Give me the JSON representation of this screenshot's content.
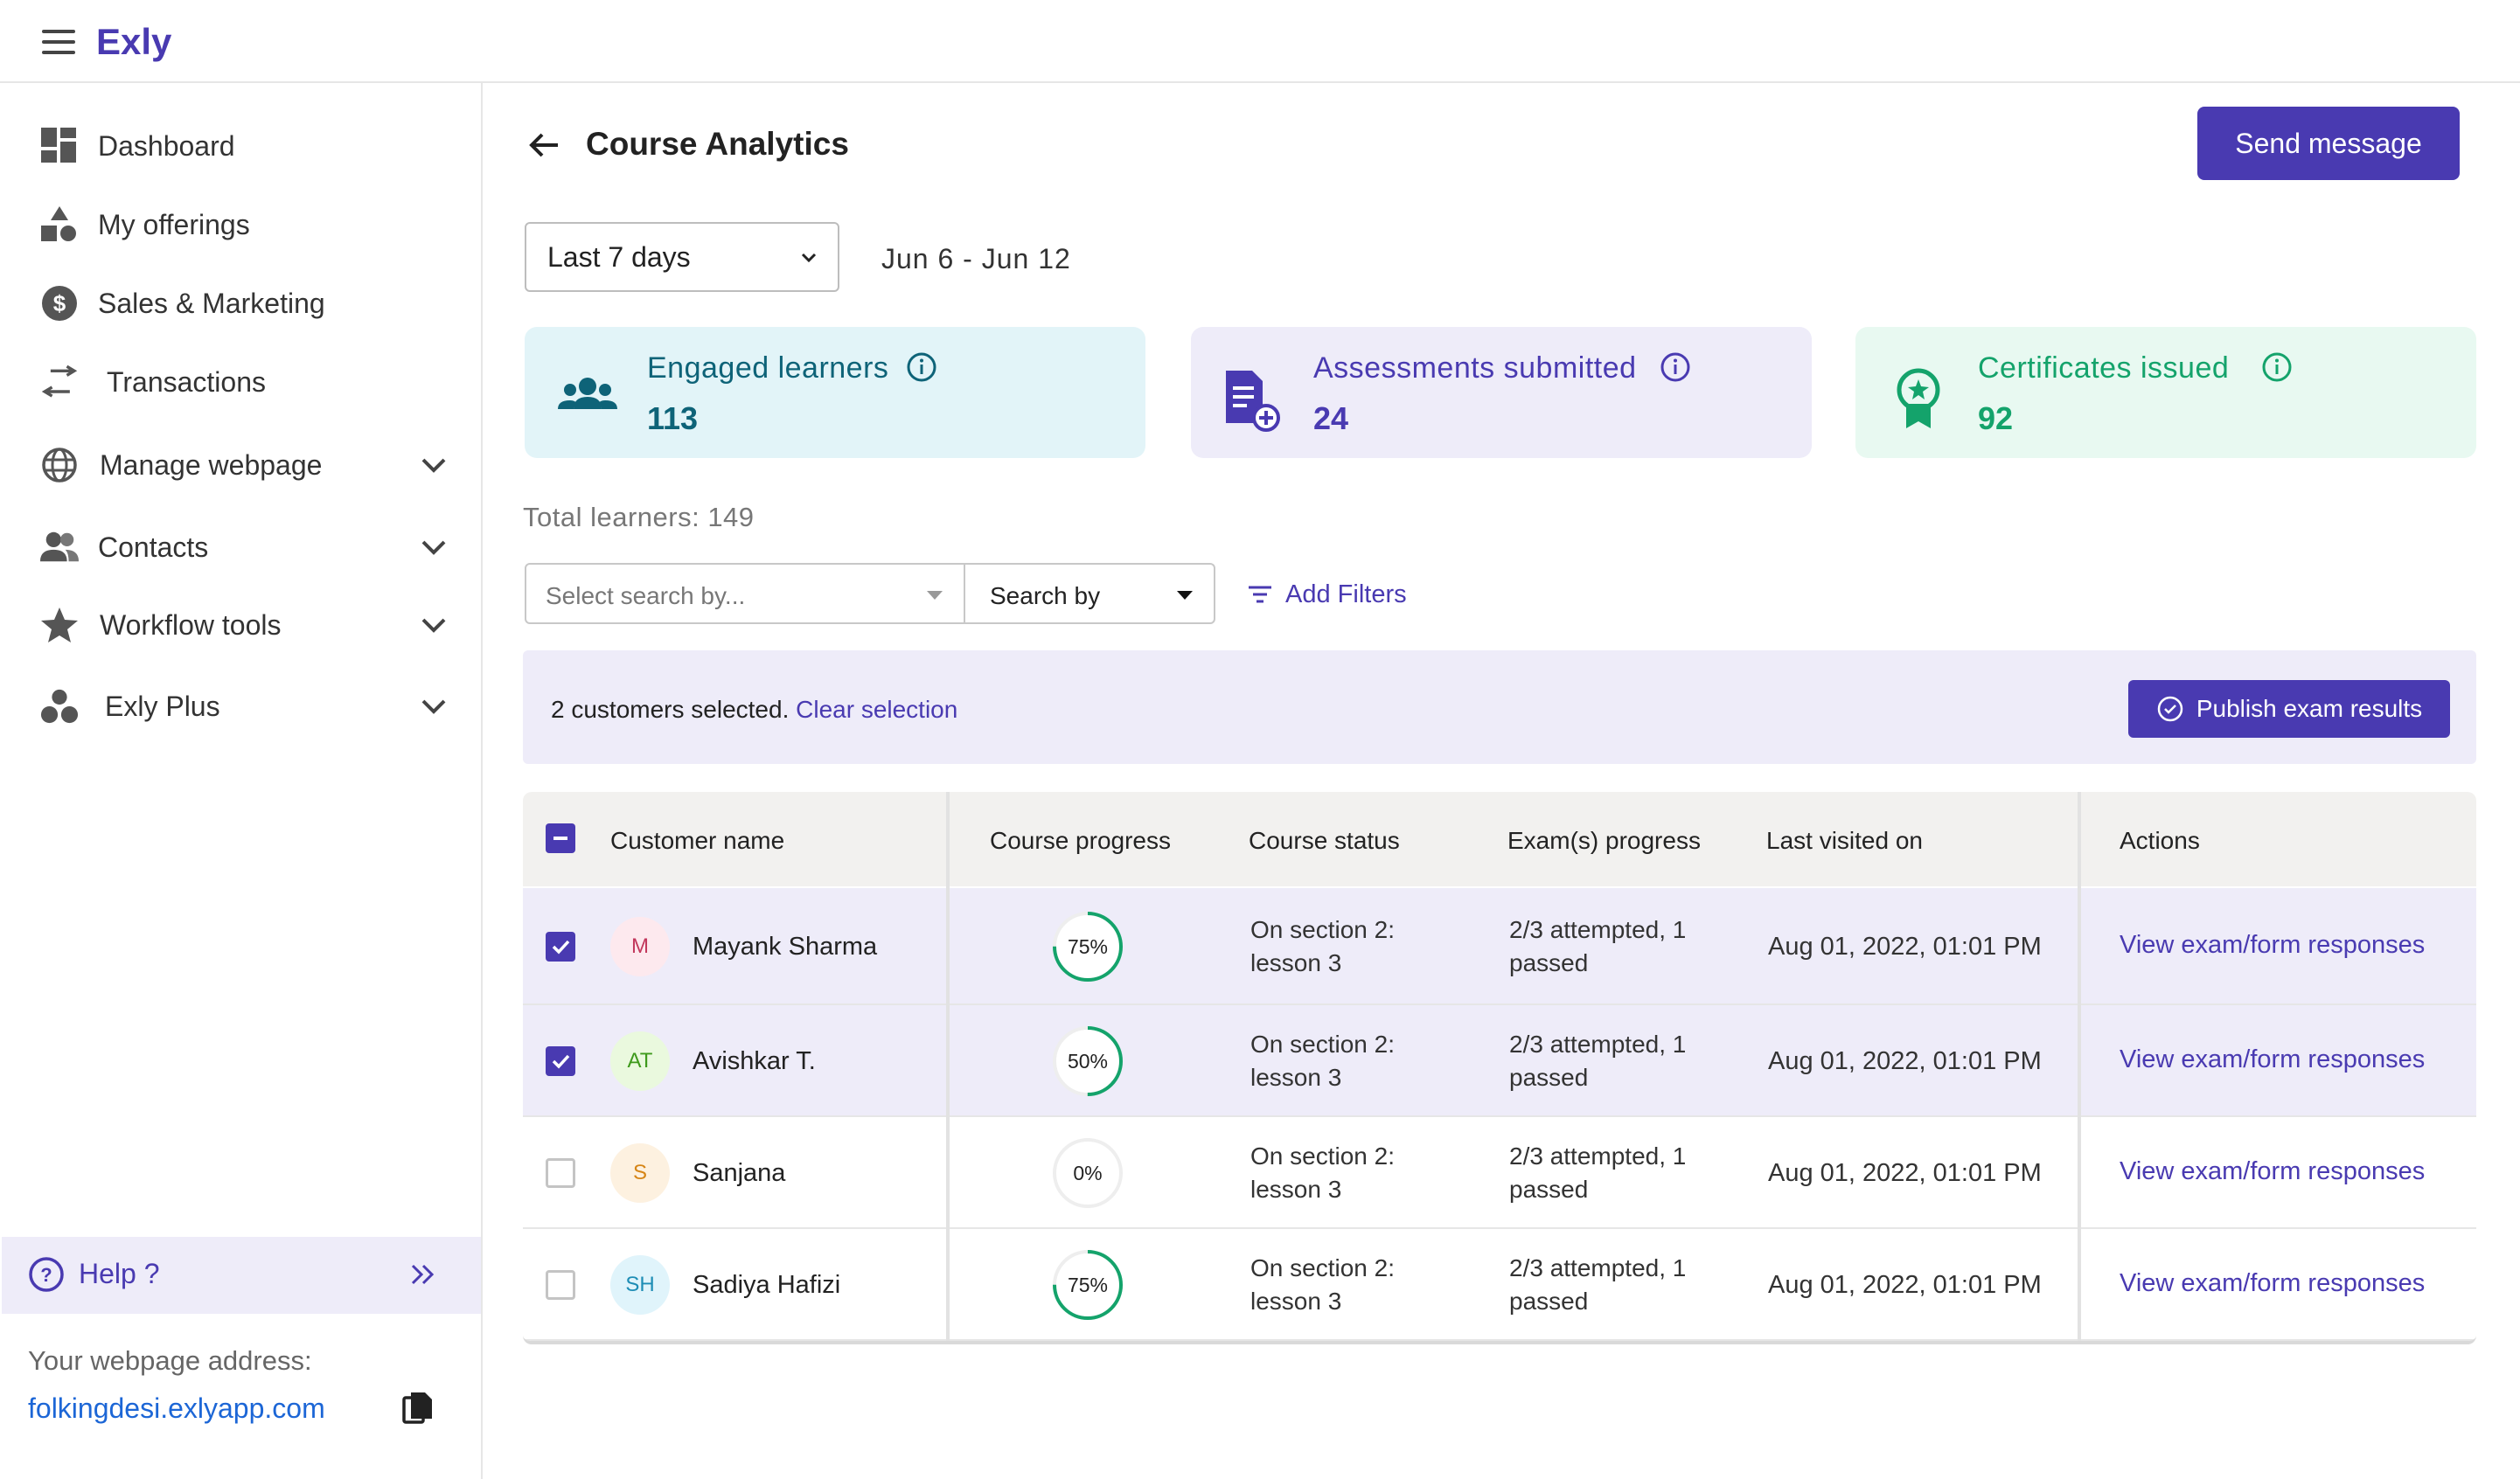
{
  "app": {
    "logo": "Exly"
  },
  "sidebar": {
    "items": [
      {
        "label": "Dashboard",
        "icon": "dashboard-icon",
        "expandable": false
      },
      {
        "label": "My offerings",
        "icon": "offerings-icon",
        "expandable": false
      },
      {
        "label": "Sales & Marketing",
        "icon": "dollar-icon",
        "expandable": false
      },
      {
        "label": "Transactions",
        "icon": "transfer-arrows-icon",
        "expandable": false
      },
      {
        "label": "Manage webpage",
        "icon": "globe-icon",
        "expandable": true
      },
      {
        "label": "Contacts",
        "icon": "contacts-icon",
        "expandable": true
      },
      {
        "label": "Workflow tools",
        "icon": "star-icon",
        "expandable": true
      },
      {
        "label": "Exly Plus",
        "icon": "exly-plus-icon",
        "expandable": true
      }
    ],
    "help_label": "Help ?",
    "webpage_address_title": "Your webpage address:",
    "webpage_address": "folkingdesi.exlyapp.com"
  },
  "header": {
    "title": "Course Analytics",
    "send_message_label": "Send message"
  },
  "filters": {
    "period": "Last 7 days",
    "date_range": "Jun 6 - Jun 12",
    "search_placeholder": "Select search by...",
    "search_by_label": "Search by",
    "add_filters_label": "Add Filters"
  },
  "stats": [
    {
      "label": "Engaged learners",
      "value": "113",
      "icon": "learners-icon",
      "color": "#0e6378",
      "bg": "#e2f4f8"
    },
    {
      "label": "Assessments submitted",
      "value": "24",
      "icon": "assessment-icon",
      "color": "#493ab1",
      "bg": "#eeecf9"
    },
    {
      "label": "Certificates issued",
      "value": "92",
      "icon": "certificate-icon",
      "color": "#14a36b",
      "bg": "#e8f9f1"
    }
  ],
  "total_learners": "Total learners: 149",
  "selection": {
    "text": "2 customers selected.",
    "clear_label": "Clear selection",
    "publish_label": "Publish exam results"
  },
  "table": {
    "columns": [
      "Customer name",
      "Course progress",
      "Course status",
      "Exam(s) progress",
      "Last visited on",
      "Actions"
    ],
    "rows": [
      {
        "selected": true,
        "initials": "M",
        "avatar_bg": "#fde9ee",
        "avatar_fg": "#c2385c",
        "name": "Mayank Sharma",
        "progress": 75,
        "progress_label": "75%",
        "status_line1": "On section 2:",
        "status_line2": "lesson 3",
        "exam_line1": "2/3 attempted, 1",
        "exam_line2": "passed",
        "last_visited": "Aug 01, 2022, 01:01 PM",
        "action": "View exam/form responses"
      },
      {
        "selected": true,
        "initials": "AT",
        "avatar_bg": "#eaf9de",
        "avatar_fg": "#3f9a1c",
        "name": "Avishkar T.",
        "progress": 50,
        "progress_label": "50%",
        "status_line1": "On section 2:",
        "status_line2": "lesson 3",
        "exam_line1": "2/3 attempted, 1",
        "exam_line2": "passed",
        "last_visited": "Aug 01, 2022, 01:01 PM",
        "action": "View exam/form responses"
      },
      {
        "selected": false,
        "initials": "S",
        "avatar_bg": "#fdf1e0",
        "avatar_fg": "#d68516",
        "name": "Sanjana",
        "progress": 0,
        "progress_label": "0%",
        "status_line1": "On section 2:",
        "status_line2": "lesson 3",
        "exam_line1": "2/3 attempted, 1",
        "exam_line2": "passed",
        "last_visited": "Aug 01, 2022, 01:01 PM",
        "action": "View exam/form responses"
      },
      {
        "selected": false,
        "initials": "SH",
        "avatar_bg": "#e0f4fb",
        "avatar_fg": "#1e8db5",
        "name": "Sadiya Hafizi",
        "progress": 75,
        "progress_label": "75%",
        "status_line1": "On section 2:",
        "status_line2": "lesson 3",
        "exam_line1": "2/3 attempted, 1",
        "exam_line2": "passed",
        "last_visited": "Aug 01, 2022, 01:01 PM",
        "action": "View exam/form responses"
      }
    ]
  },
  "colors": {
    "brand": "#493ab1",
    "progress": "#14a36b",
    "link": "#1c66d6"
  }
}
